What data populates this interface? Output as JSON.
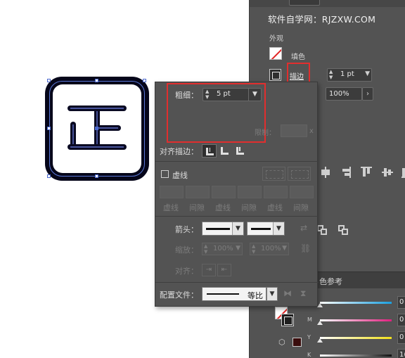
{
  "watermark": "软件自学网：RJZXW.COM",
  "appearance_panel": {
    "section_title": "外观",
    "fill_label": "填色",
    "stroke_label": "描边",
    "stroke_weight": "1 pt",
    "opacity": "100%",
    "opacity_arrow": "›"
  },
  "stroke_panel": {
    "weight_label": "粗细：",
    "weight_value": "5 pt",
    "limit_label": "限制：",
    "limit_suffix": "x",
    "align_label": "对齐描边：",
    "dashed_label": "虚线",
    "dash_captions": [
      "虚线",
      "间隙",
      "虚线",
      "间隙",
      "虚线",
      "间隙"
    ],
    "arrowheads_label": "箭头：",
    "scale_label": "缩放：",
    "scale_start": "100%",
    "scale_end": "100%",
    "align_arrow_label": "对齐：",
    "profile_label": "配置文件：",
    "profile_value": "等比"
  },
  "color_panel": {
    "tab_title": "色参考",
    "channels": [
      "C",
      "M",
      "Y",
      "K"
    ],
    "values": [
      "0",
      "0",
      "0",
      "1("
    ]
  },
  "icons": {
    "dropdown": "chevron-down-icon",
    "stepper": "stepper-arrows-icon",
    "swap": "swap-arrows-icon",
    "link": "link-icon",
    "flip_h": "flip-horizontal-icon",
    "flip_v": "flip-vertical-icon",
    "cube": "cube-icon"
  },
  "colors": {
    "panel_bg": "#535353",
    "highlight_red": "#e12e2e",
    "selection_blue": "#5b78d8",
    "artwork_dark": "#06061a"
  }
}
